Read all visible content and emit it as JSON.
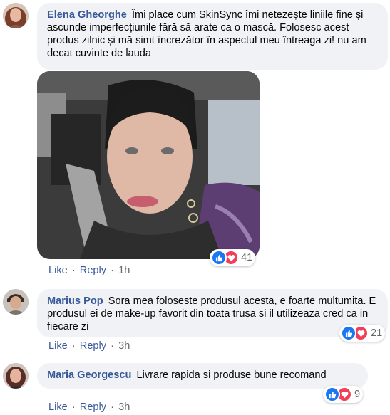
{
  "comments": [
    {
      "author": "Elena Gheorghe",
      "text": "Îmi place cum SkinSync îmi netezește liniile fine și ascunde imperfecțiunile fără să arate ca o mască. Folosesc acest produs zilnic și mă simt încrezător în aspectul meu întreaga zi! nu am decat cuvinte de lauda",
      "like_label": "Like",
      "reply_label": "Reply",
      "separator": "·",
      "time": "1h",
      "reaction_count": "41",
      "reaction_icons": [
        "like-icon",
        "love-icon"
      ]
    },
    {
      "author": "Marius Pop",
      "text": "Sora mea foloseste produsul acesta, e foarte multumita. E produsul ei de make-up favorit din toata trusa si il utilizeaza cred ca in fiecare zi",
      "like_label": "Like",
      "reply_label": "Reply",
      "separator": "·",
      "time": "3h",
      "reaction_count": "21",
      "reaction_icons": [
        "like-icon",
        "love-icon"
      ]
    },
    {
      "author": "Maria Georgescu",
      "text": "Livrare rapida si produse bune recomand",
      "like_label": "Like",
      "reply_label": "Reply",
      "separator": "·",
      "time": "3h",
      "reaction_count": "9",
      "reaction_icons": [
        "like-icon",
        "love-icon"
      ]
    }
  ],
  "colors": {
    "author_link": "#385898",
    "bubble_bg": "#f0f2f5",
    "like_blue": "#1877f2",
    "love_red": "#f33e58",
    "meta_gray": "#65676b"
  }
}
